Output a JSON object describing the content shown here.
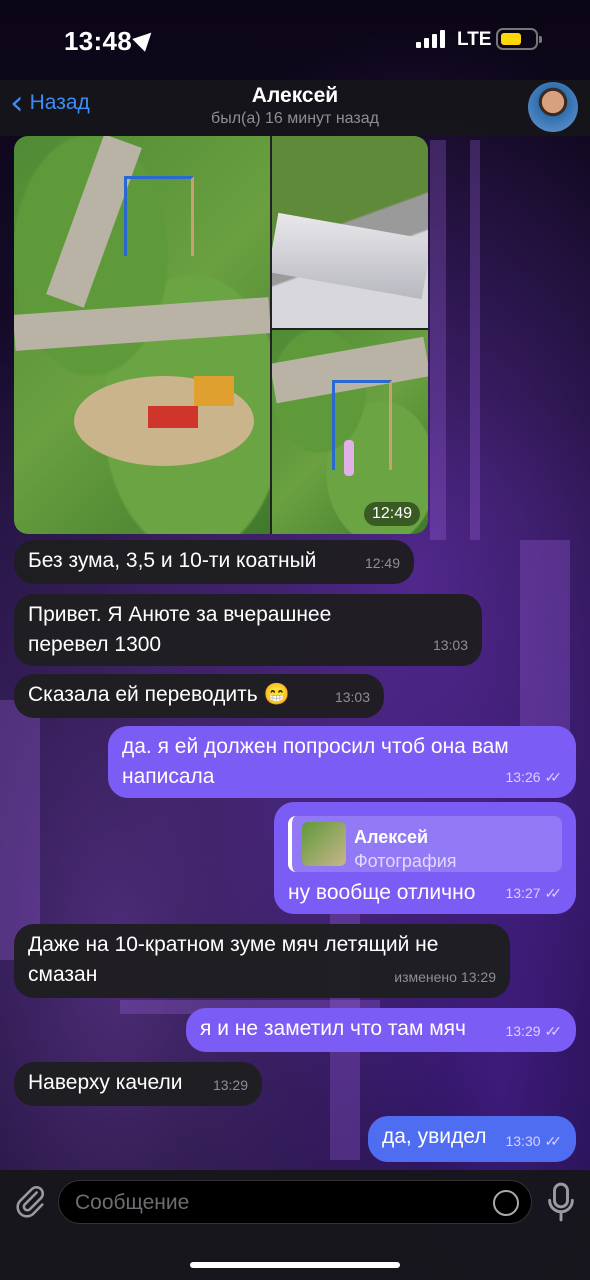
{
  "status_bar": {
    "time": "13:48",
    "network": "LTE"
  },
  "header": {
    "back_label": "Назад",
    "contact_name": "Алексей",
    "last_seen": "был(а) 16 минут назад"
  },
  "album": {
    "time": "12:49"
  },
  "messages": [
    {
      "text": "Без зума, 3,5 и 10-ти коатный",
      "time": "12:49",
      "direction": "in"
    },
    {
      "text": "Привет. Я Анюте за вчерашнее перевел 1300",
      "time": "13:03",
      "direction": "in"
    },
    {
      "text": "Сказала ей переводить 😁",
      "time": "13:03",
      "direction": "in"
    },
    {
      "text": "да. я ей должен попросил чтоб она вам написала",
      "time": "13:26",
      "direction": "out"
    },
    {
      "text": "ну вообще отлично",
      "time": "13:27",
      "direction": "out",
      "reply_name": "Алексей",
      "reply_text": "Фотография"
    },
    {
      "text": "Даже на 10-кратном зуме мяч летящий не смазан",
      "time": "13:29",
      "edited": "изменено",
      "direction": "in"
    },
    {
      "text": "я и не заметил что там мяч",
      "time": "13:29",
      "direction": "out"
    },
    {
      "text": "Наверху качели",
      "time": "13:29",
      "direction": "in"
    },
    {
      "text": "да, увидел",
      "time": "13:30",
      "direction": "out"
    }
  ],
  "composer": {
    "placeholder": "Сообщение"
  },
  "colors": {
    "accent": "#3e8cf5",
    "outgoing": "#7b5cf5",
    "incoming": "#1e1e20"
  }
}
